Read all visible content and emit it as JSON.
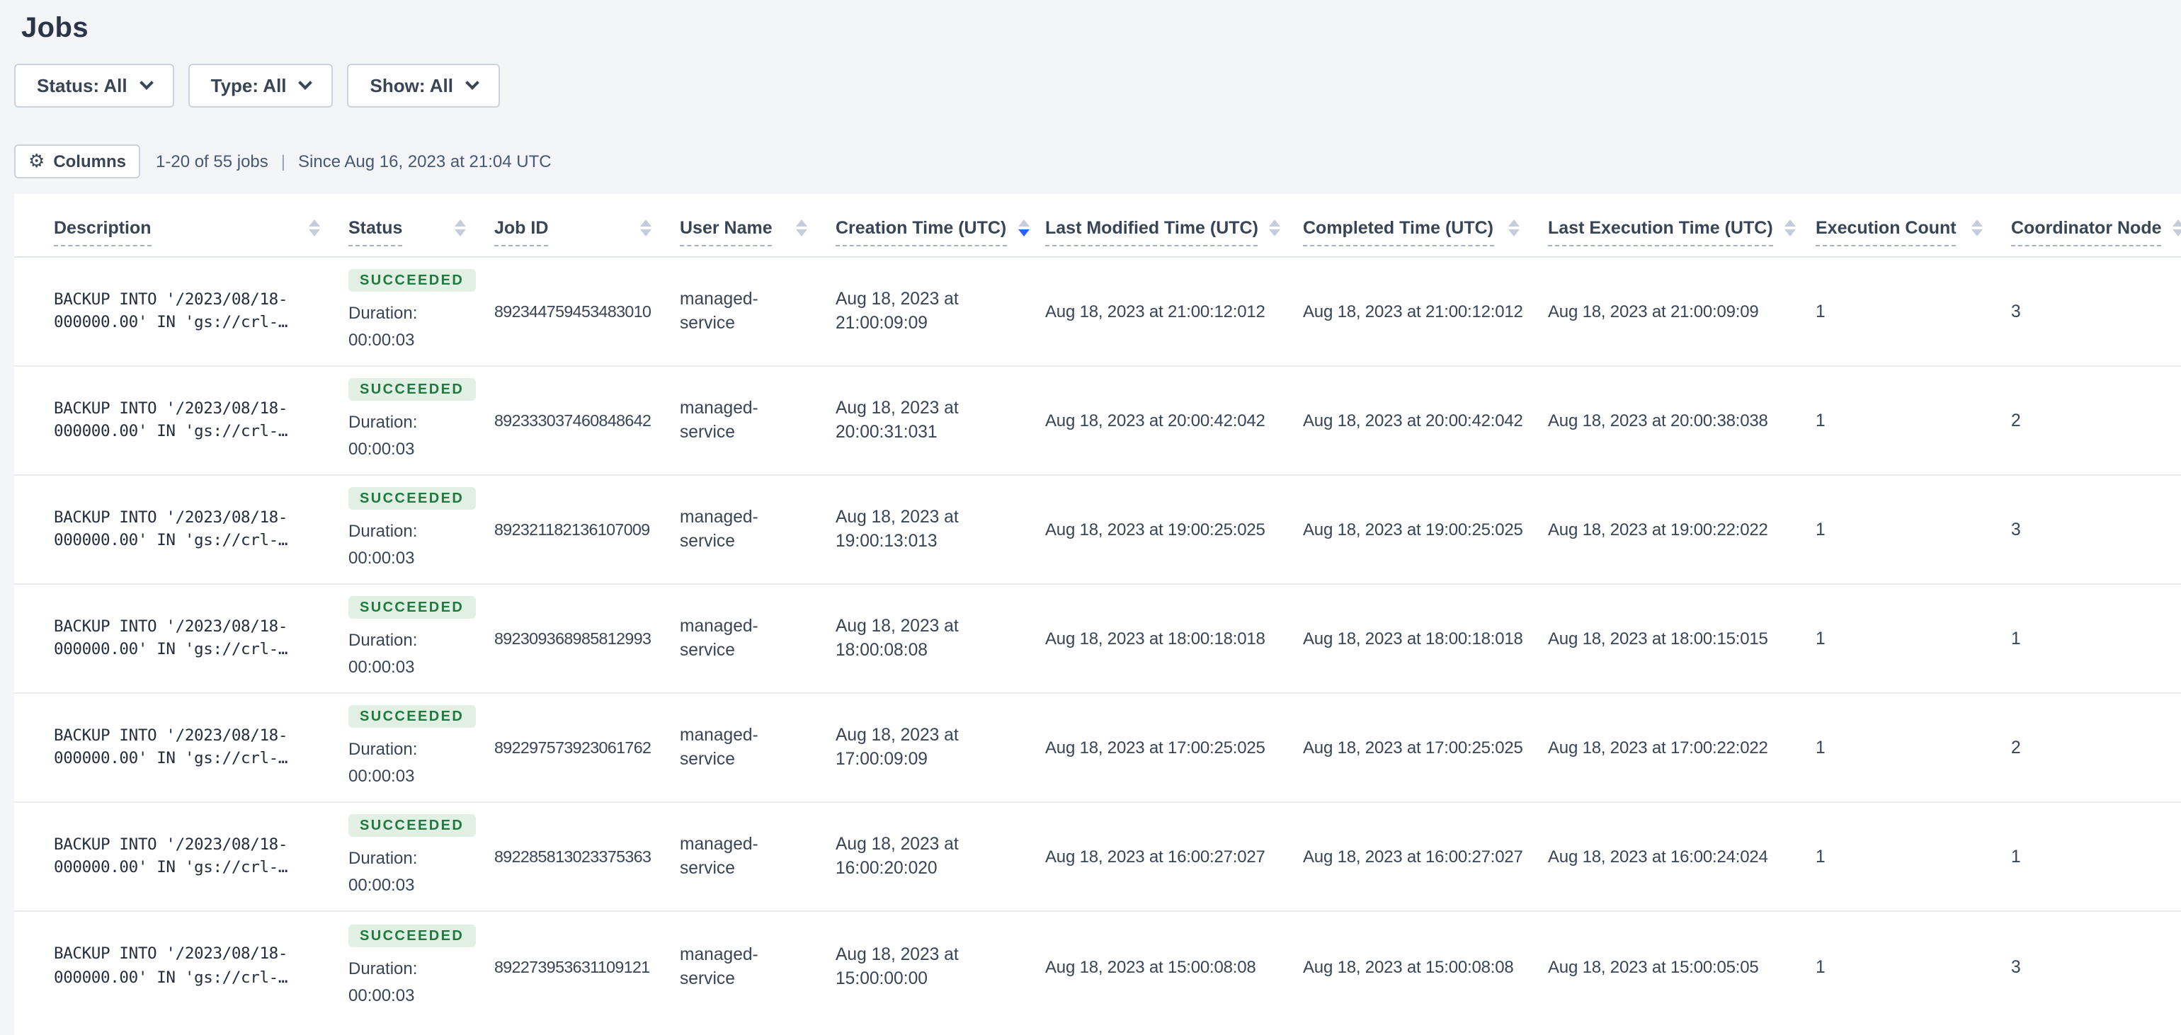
{
  "page": {
    "title": "Jobs"
  },
  "filters": [
    {
      "label": "Status: All"
    },
    {
      "label": "Type: All"
    },
    {
      "label": "Show: All"
    }
  ],
  "toolbar": {
    "columns_label": "Columns",
    "columns_icon": "gear-icon",
    "count_text": "1-20 of 55 jobs",
    "separator": "|",
    "since_text": "Since Aug 16, 2023 at 21:04 UTC"
  },
  "table": {
    "columns": [
      {
        "label": "Description",
        "sorted": "none"
      },
      {
        "label": "Status",
        "sorted": "none"
      },
      {
        "label": "Job ID",
        "sorted": "none"
      },
      {
        "label": "User Name",
        "sorted": "none"
      },
      {
        "label": "Creation Time (UTC)",
        "sorted": "desc"
      },
      {
        "label": "Last Modified Time (UTC)",
        "sorted": "none"
      },
      {
        "label": "Completed Time (UTC)",
        "sorted": "none"
      },
      {
        "label": "Last Execution Time (UTC)",
        "sorted": "none"
      },
      {
        "label": "Execution Count",
        "sorted": "none"
      },
      {
        "label": "Coordinator Node",
        "sorted": "none"
      }
    ],
    "rows": [
      {
        "description_line1": "BACKUP INTO '/2023/08/18-",
        "description_line2": "000000.00' IN 'gs://crl-…",
        "status": "SUCCEEDED",
        "duration": "Duration: 00:00:03",
        "job_id": "892344759453483010",
        "user_name": "managed-service",
        "creation_time": "Aug 18, 2023 at 21:00:09:09",
        "last_modified_time": "Aug 18, 2023 at 21:00:12:012",
        "completed_time": "Aug 18, 2023 at 21:00:12:012",
        "last_execution_time": "Aug 18, 2023 at 21:00:09:09",
        "execution_count": "1",
        "coordinator_node": "3"
      },
      {
        "description_line1": "BACKUP INTO '/2023/08/18-",
        "description_line2": "000000.00' IN 'gs://crl-…",
        "status": "SUCCEEDED",
        "duration": "Duration: 00:00:03",
        "job_id": "892333037460848642",
        "user_name": "managed-service",
        "creation_time": "Aug 18, 2023 at 20:00:31:031",
        "last_modified_time": "Aug 18, 2023 at 20:00:42:042",
        "completed_time": "Aug 18, 2023 at 20:00:42:042",
        "last_execution_time": "Aug 18, 2023 at 20:00:38:038",
        "execution_count": "1",
        "coordinator_node": "2"
      },
      {
        "description_line1": "BACKUP INTO '/2023/08/18-",
        "description_line2": "000000.00' IN 'gs://crl-…",
        "status": "SUCCEEDED",
        "duration": "Duration: 00:00:03",
        "job_id": "892321182136107009",
        "user_name": "managed-service",
        "creation_time": "Aug 18, 2023 at 19:00:13:013",
        "last_modified_time": "Aug 18, 2023 at 19:00:25:025",
        "completed_time": "Aug 18, 2023 at 19:00:25:025",
        "last_execution_time": "Aug 18, 2023 at 19:00:22:022",
        "execution_count": "1",
        "coordinator_node": "3"
      },
      {
        "description_line1": "BACKUP INTO '/2023/08/18-",
        "description_line2": "000000.00' IN 'gs://crl-…",
        "status": "SUCCEEDED",
        "duration": "Duration: 00:00:03",
        "job_id": "892309368985812993",
        "user_name": "managed-service",
        "creation_time": "Aug 18, 2023 at 18:00:08:08",
        "last_modified_time": "Aug 18, 2023 at 18:00:18:018",
        "completed_time": "Aug 18, 2023 at 18:00:18:018",
        "last_execution_time": "Aug 18, 2023 at 18:00:15:015",
        "execution_count": "1",
        "coordinator_node": "1"
      },
      {
        "description_line1": "BACKUP INTO '/2023/08/18-",
        "description_line2": "000000.00' IN 'gs://crl-…",
        "status": "SUCCEEDED",
        "duration": "Duration: 00:00:03",
        "job_id": "892297573923061762",
        "user_name": "managed-service",
        "creation_time": "Aug 18, 2023 at 17:00:09:09",
        "last_modified_time": "Aug 18, 2023 at 17:00:25:025",
        "completed_time": "Aug 18, 2023 at 17:00:25:025",
        "last_execution_time": "Aug 18, 2023 at 17:00:22:022",
        "execution_count": "1",
        "coordinator_node": "2"
      },
      {
        "description_line1": "BACKUP INTO '/2023/08/18-",
        "description_line2": "000000.00' IN 'gs://crl-…",
        "status": "SUCCEEDED",
        "duration": "Duration: 00:00:03",
        "job_id": "892285813023375363",
        "user_name": "managed-service",
        "creation_time": "Aug 18, 2023 at 16:00:20:020",
        "last_modified_time": "Aug 18, 2023 at 16:00:27:027",
        "completed_time": "Aug 18, 2023 at 16:00:27:027",
        "last_execution_time": "Aug 18, 2023 at 16:00:24:024",
        "execution_count": "1",
        "coordinator_node": "1"
      },
      {
        "description_line1": "BACKUP INTO '/2023/08/18-",
        "description_line2": "000000.00' IN 'gs://crl-…",
        "status": "SUCCEEDED",
        "duration": "Duration: 00:00:03",
        "job_id": "892273953631109121",
        "user_name": "managed-service",
        "creation_time": "Aug 18, 2023 at 15:00:00:00",
        "last_modified_time": "Aug 18, 2023 at 15:00:08:08",
        "completed_time": "Aug 18, 2023 at 15:00:08:08",
        "last_execution_time": "Aug 18, 2023 at 15:00:05:05",
        "execution_count": "1",
        "coordinator_node": "3"
      }
    ]
  },
  "colors": {
    "page_background": "#f4f5f9",
    "sort_active_blue": "#2962ff",
    "succeeded_text": "#1f7a40",
    "succeeded_bg": "#e2f0e4"
  }
}
